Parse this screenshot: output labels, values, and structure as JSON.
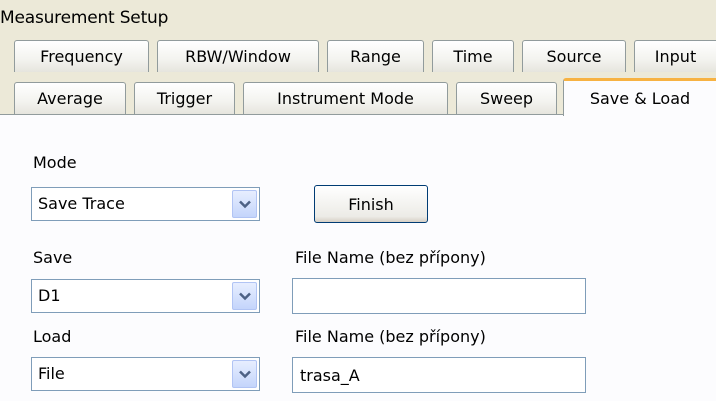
{
  "window": {
    "title": "Measurement Setup"
  },
  "tabs": {
    "row1": [
      {
        "id": "frequency",
        "label": "Frequency"
      },
      {
        "id": "rbw-window",
        "label": "RBW/Window"
      },
      {
        "id": "range",
        "label": "Range"
      },
      {
        "id": "time",
        "label": "Time"
      },
      {
        "id": "source",
        "label": "Source"
      },
      {
        "id": "input",
        "label": "Input"
      }
    ],
    "row2": [
      {
        "id": "average",
        "label": "Average"
      },
      {
        "id": "trigger",
        "label": "Trigger"
      },
      {
        "id": "instrument-mode",
        "label": "Instrument Mode"
      },
      {
        "id": "sweep",
        "label": "Sweep"
      },
      {
        "id": "save-load",
        "label": "Save & Load",
        "active": true
      }
    ]
  },
  "form": {
    "mode_label": "Mode",
    "mode_value": "Save Trace",
    "finish_label": "Finish",
    "save_label": "Save",
    "save_value": "D1",
    "save_filename_label": "File Name (bez přípony)",
    "save_filename_value": "",
    "load_label": "Load",
    "load_value": "File",
    "load_filename_label": "File Name (bez přípony)",
    "load_filename_value": "trasa_A"
  },
  "colors": {
    "background": "#ece9d8",
    "panel": "#fcfcfe",
    "active_tab_accent": "#f7b242",
    "control_border": "#7f9db9"
  },
  "icons": {
    "dropdown": "chevron-down-icon"
  }
}
